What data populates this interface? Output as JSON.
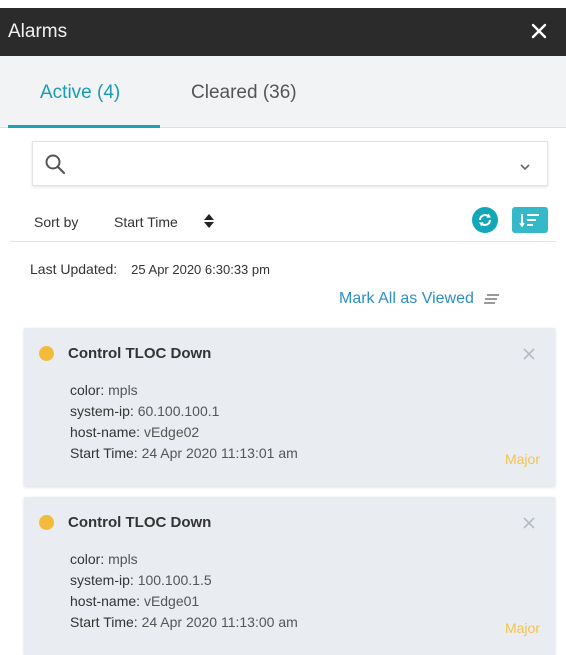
{
  "header": {
    "title": "Alarms"
  },
  "tabs": [
    {
      "label": "Active (4)",
      "active": true
    },
    {
      "label": "Cleared (36)",
      "active": false
    }
  ],
  "search": {
    "value": "",
    "placeholder": ""
  },
  "sort": {
    "label": "Sort by",
    "value": "Start Time"
  },
  "last_updated": {
    "label": "Last Updated:",
    "value": "25 Apr 2020 6:30:33 pm"
  },
  "mark_all_label": "Mark All as Viewed",
  "alarms": [
    {
      "title": "Control TLOC Down",
      "fields": [
        {
          "key": "color:",
          "value": "mpls"
        },
        {
          "key": "system-ip:",
          "value": "60.100.100.1"
        },
        {
          "key": "host-name:",
          "value": "vEdge02"
        },
        {
          "key": "Start Time:",
          "value": "24 Apr 2020 11:13:01 am"
        }
      ],
      "severity": "Major"
    },
    {
      "title": "Control TLOC Down",
      "fields": [
        {
          "key": "color:",
          "value": "mpls"
        },
        {
          "key": "system-ip:",
          "value": "100.100.1.5"
        },
        {
          "key": "host-name:",
          "value": "vEdge01"
        },
        {
          "key": "Start Time:",
          "value": "24 Apr 2020 11:13:00 am"
        }
      ],
      "severity": "Major"
    }
  ],
  "colors": {
    "accent": "#1a9cb0",
    "severity_major": "#f3c34d",
    "title_bar": "#2b2b2b",
    "card_bg": "#e9edf2"
  }
}
